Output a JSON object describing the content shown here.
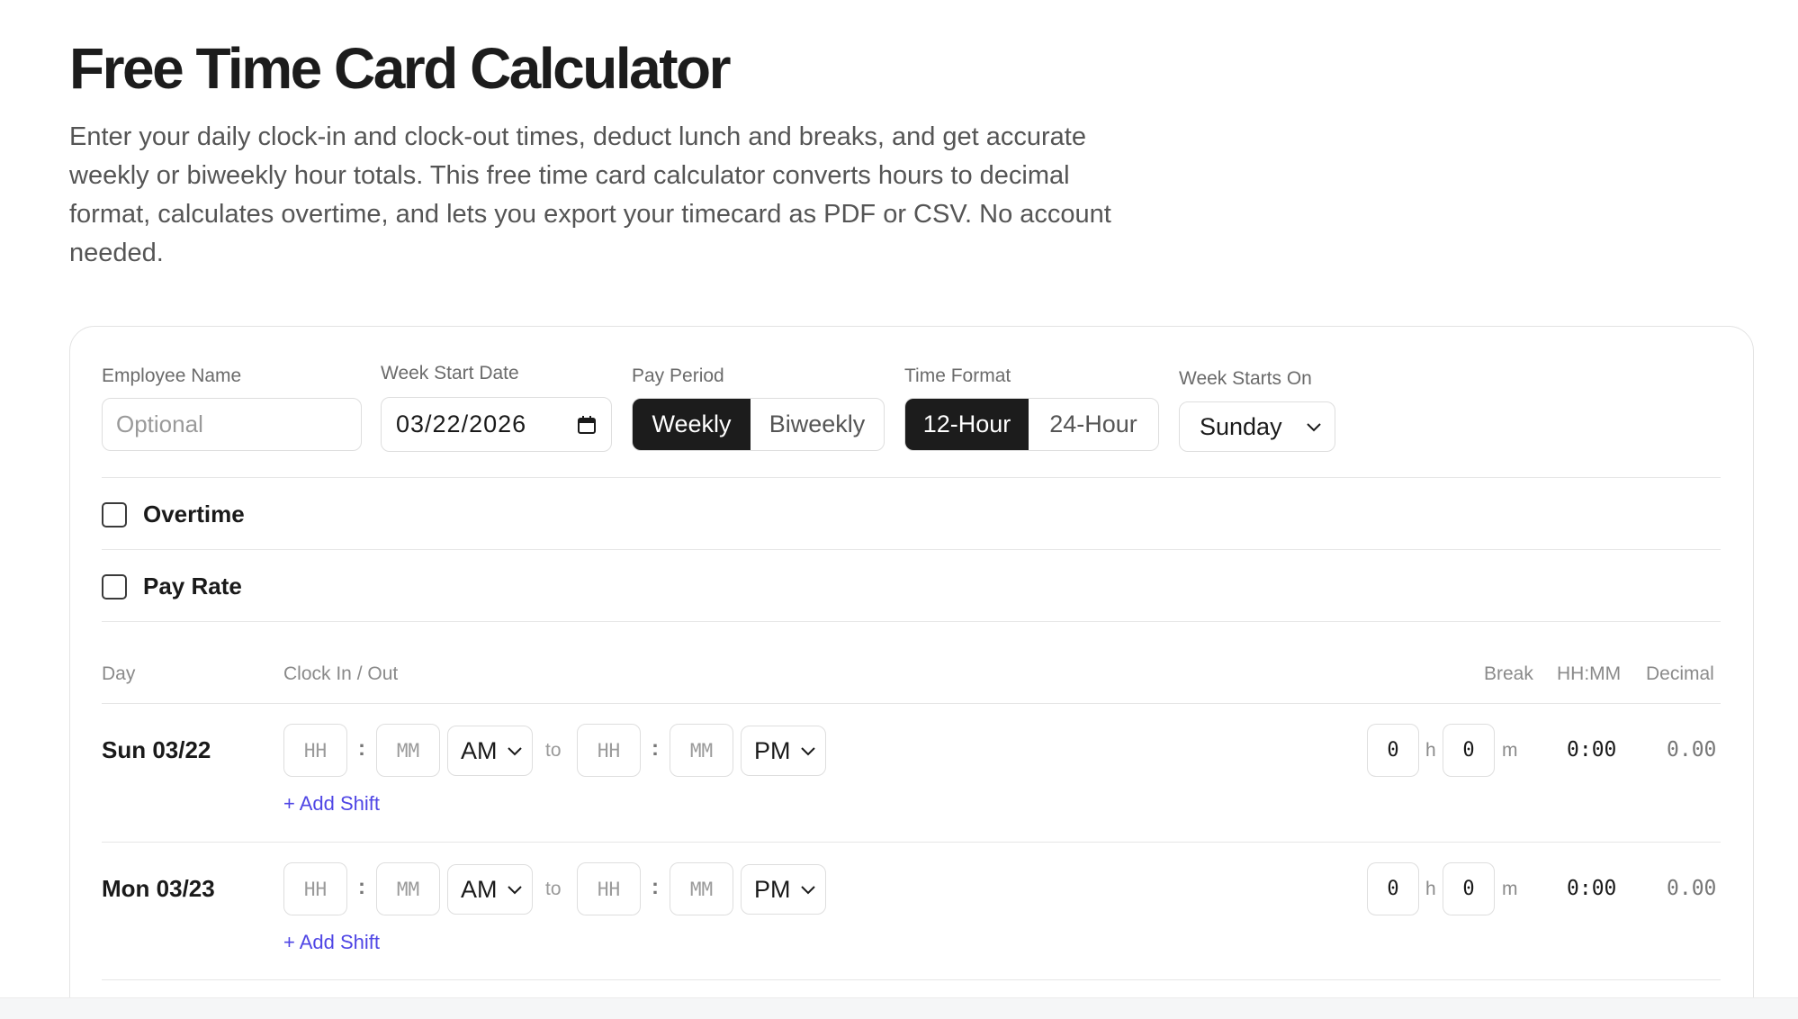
{
  "page": {
    "title": "Free Time Card Calculator",
    "intro": "Enter your daily clock-in and clock-out times, deduct lunch and breaks, and get accurate weekly or biweekly hour totals. This free time card calculator converts hours to decimal format, calculates overtime, and lets you export your timecard as PDF or CSV. No account needed."
  },
  "settings": {
    "employee_name": {
      "label": "Employee Name",
      "placeholder": "Optional",
      "value": ""
    },
    "week_start_date": {
      "label": "Week Start Date",
      "value": "03/22/2026"
    },
    "pay_period": {
      "label": "Pay Period",
      "options": [
        "Weekly",
        "Biweekly"
      ],
      "selected": "Weekly"
    },
    "time_format": {
      "label": "Time Format",
      "options": [
        "12-Hour",
        "24-Hour"
      ],
      "selected": "12-Hour"
    },
    "week_starts_on": {
      "label": "Week Starts On",
      "value": "Sunday"
    }
  },
  "toggles": {
    "overtime": {
      "label": "Overtime",
      "checked": false
    },
    "pay_rate": {
      "label": "Pay Rate",
      "checked": false
    }
  },
  "table": {
    "headers": {
      "day": "Day",
      "clock": "Clock In / Out",
      "break": "Break",
      "hhmm": "HH:MM",
      "decimal": "Decimal"
    },
    "placeholders": {
      "hh": "HH",
      "mm": "MM"
    },
    "separator": ":",
    "to_label": "to",
    "unit_h": "h",
    "unit_m": "m",
    "add_shift_label": "+ Add Shift",
    "rows": [
      {
        "day": "Sun 03/22",
        "in_period": "AM",
        "out_period": "PM",
        "break_h": "0",
        "break_m": "0",
        "hhmm": "0:00",
        "decimal": "0.00"
      },
      {
        "day": "Mon 03/23",
        "in_period": "AM",
        "out_period": "PM",
        "break_h": "0",
        "break_m": "0",
        "hhmm": "0:00",
        "decimal": "0.00"
      }
    ]
  },
  "colors": {
    "accent_dark": "#1c1c1c",
    "link": "#4f46e5",
    "border": "#dedede"
  }
}
